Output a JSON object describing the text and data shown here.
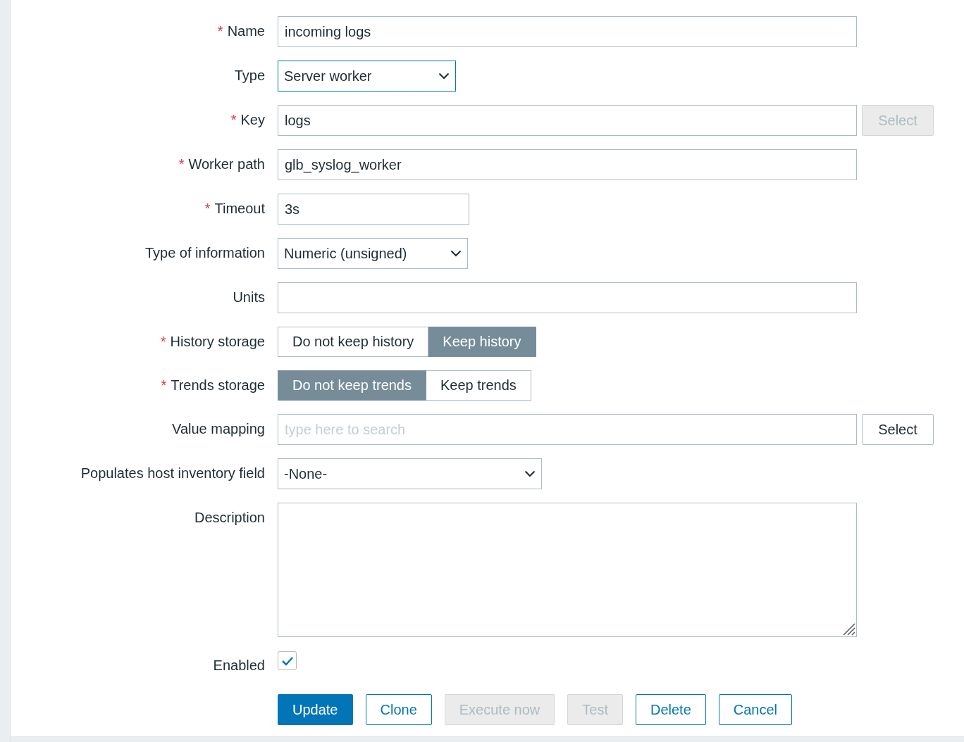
{
  "fields": [
    {
      "label": "Name",
      "required_mark": "*",
      "kind": "text",
      "value": "incoming logs"
    },
    {
      "label": "Type",
      "kind": "select",
      "value": "Server worker",
      "focused": true
    },
    {
      "label": "Key",
      "required_mark": "*",
      "kind": "text",
      "value": "logs",
      "button": {
        "label": "Select",
        "disabled": true
      }
    },
    {
      "label": "Worker path",
      "required_mark": "*",
      "kind": "text",
      "value": "glb_syslog_worker"
    },
    {
      "label": "Timeout",
      "required_mark": "*",
      "kind": "text",
      "value": "3s"
    },
    {
      "label": "Type of information",
      "kind": "select",
      "value": "Numeric (unsigned)",
      "focused": false
    },
    {
      "label": "Units",
      "kind": "text"
    },
    {
      "label": "History storage",
      "required_mark": "*",
      "kind": "segmented",
      "options": [
        {
          "label": "Do not keep history",
          "selected": false
        },
        {
          "label": "Keep history",
          "selected": true
        }
      ]
    },
    {
      "label": "Trends storage",
      "required_mark": "*",
      "kind": "segmented",
      "options": [
        {
          "label": "Do not keep trends",
          "selected": true
        },
        {
          "label": "Keep trends",
          "selected": false
        }
      ]
    },
    {
      "label": "Value mapping",
      "kind": "text",
      "placeholder": "type here to search",
      "button": {
        "label": "Select",
        "disabled": false
      }
    },
    {
      "label": "Populates host inventory field",
      "kind": "select",
      "value": "-None-",
      "focused": false
    },
    {
      "label": "Description",
      "kind": "textarea"
    },
    {
      "label": "Enabled",
      "kind": "checkbox",
      "checked": true
    }
  ],
  "buttons": [
    {
      "label": "Update",
      "kind": "primary",
      "disabled": false
    },
    {
      "label": "Clone",
      "kind": "secondary",
      "disabled": false
    },
    {
      "label": "Execute now",
      "kind": "secondary",
      "disabled": true
    },
    {
      "label": "Test",
      "kind": "secondary",
      "disabled": true
    },
    {
      "label": "Delete",
      "kind": "secondary",
      "disabled": false
    },
    {
      "label": "Cancel",
      "kind": "secondary",
      "disabled": false
    }
  ]
}
